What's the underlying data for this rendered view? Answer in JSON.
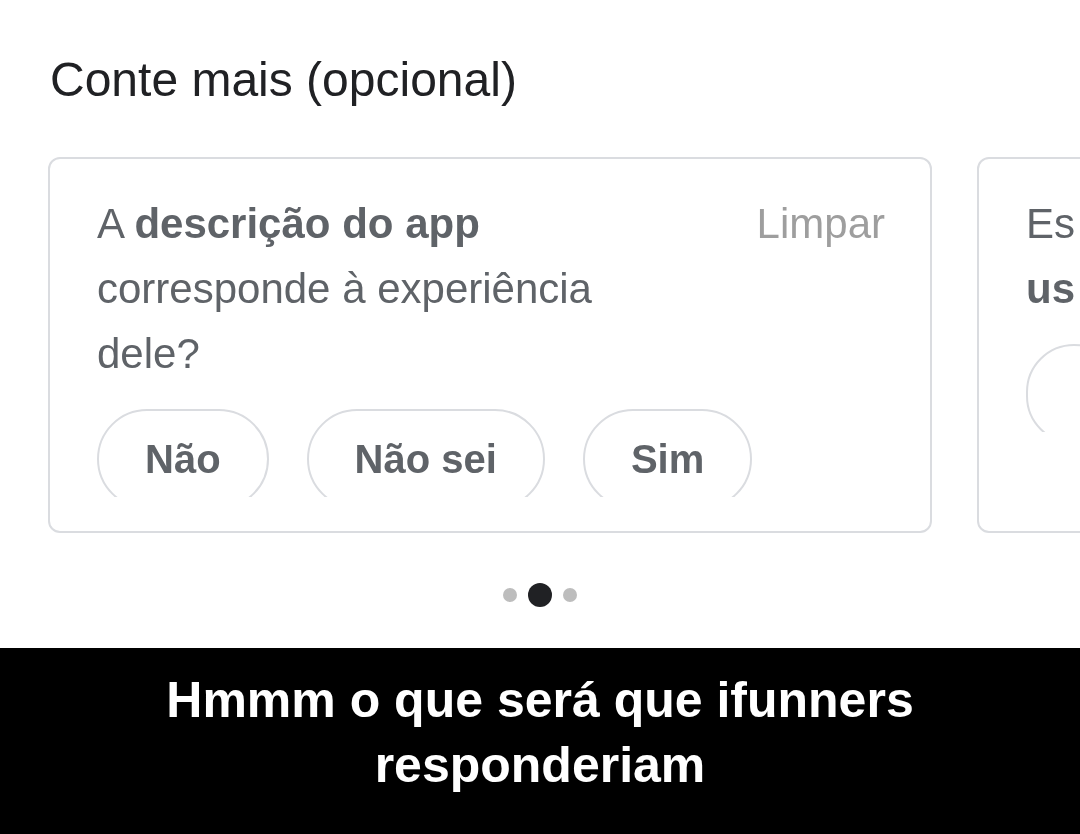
{
  "header": {
    "title": "Conte mais (opcional)"
  },
  "cards": [
    {
      "question": "A **descrição do app** corresponde à experiência dele?",
      "clear_label": "Limpar",
      "answers": [
        {
          "label": "Não",
          "selected": false
        },
        {
          "label": "Não sei",
          "selected": false
        },
        {
          "label": "Sim",
          "selected": false
        }
      ]
    },
    {
      "question": "Es\n**us**",
      "answers": [
        {
          "selected": false
        }
      ]
    }
  ],
  "pages": [
    {
      "selected": false
    },
    {
      "selected": true
    },
    {
      "selected": false
    }
  ],
  "caption": {
    "text": "Hmmm o que será que ifunners responderiam"
  }
}
